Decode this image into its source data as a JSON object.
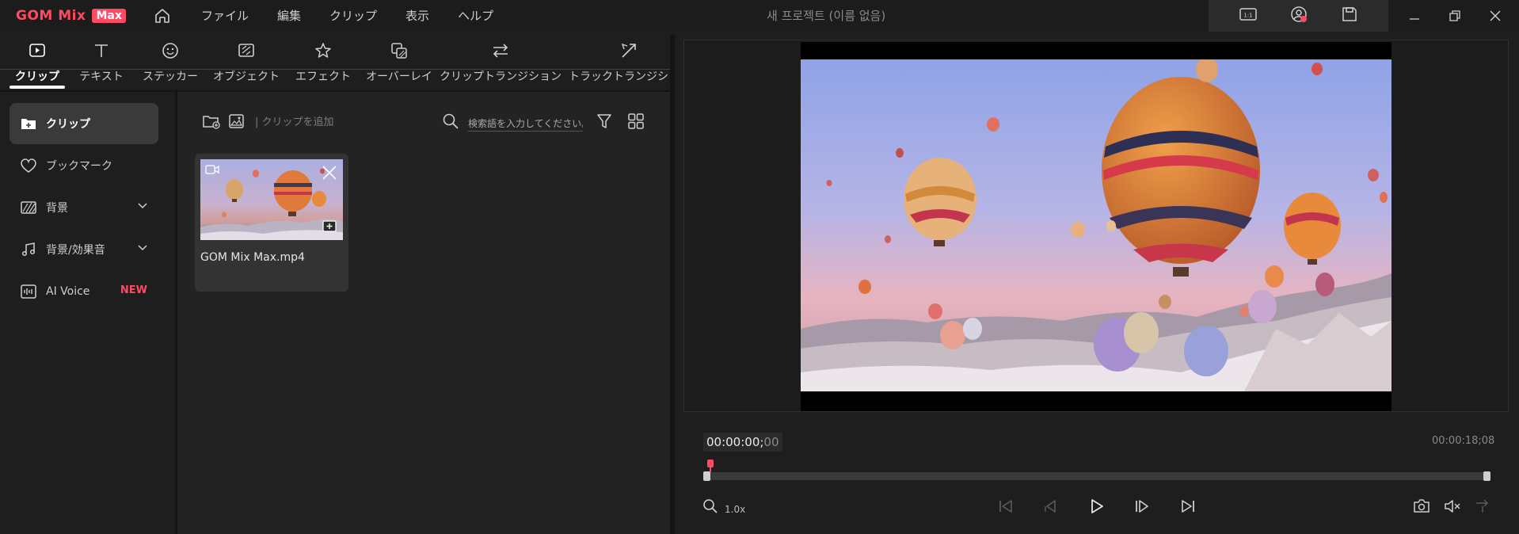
{
  "app": {
    "logo_text": "GOM Mix",
    "logo_badge": "Max",
    "document_title": "새 프로젝트 (이름 없음)",
    "accent_color": "#ff4a63"
  },
  "menu": [
    "ファイル",
    "編集",
    "クリップ",
    "表示",
    "ヘルプ"
  ],
  "tabs": [
    {
      "label": "クリップ",
      "icon": "clip-icon",
      "active": true
    },
    {
      "label": "テキスト",
      "icon": "text-icon"
    },
    {
      "label": "ステッカー",
      "icon": "sticker-icon"
    },
    {
      "label": "オブジェクト",
      "icon": "object-icon"
    },
    {
      "label": "エフェクト",
      "icon": "effect-icon"
    },
    {
      "label": "オーバーレイ",
      "icon": "overlay-icon"
    },
    {
      "label": "クリップトランジション",
      "icon": "clip-transition-icon"
    },
    {
      "label": "トラックトランジション",
      "icon": "track-transition-icon"
    }
  ],
  "sidebar": {
    "items": [
      {
        "label": "クリップ",
        "icon": "folder-add-icon",
        "active": true
      },
      {
        "label": "ブックマーク",
        "icon": "heart-icon"
      },
      {
        "label": "背景",
        "icon": "background-pattern-icon",
        "expandable": true
      },
      {
        "label": "背景/効果音",
        "icon": "music-note-icon",
        "expandable": true
      },
      {
        "label": "AI Voice",
        "icon": "waveform-icon",
        "badge": "NEW"
      }
    ]
  },
  "clips": {
    "add_label": "| クリップを追加",
    "search_placeholder": "検索語を入力してください。",
    "items": [
      {
        "name": "GOM Mix Max.mp4"
      }
    ]
  },
  "preview": {
    "time_current_main": "00:00:00;",
    "time_current_frames": "00",
    "time_total": "00:00:18;08",
    "zoom_level": "1.0x",
    "playhead_position": 0.0
  }
}
